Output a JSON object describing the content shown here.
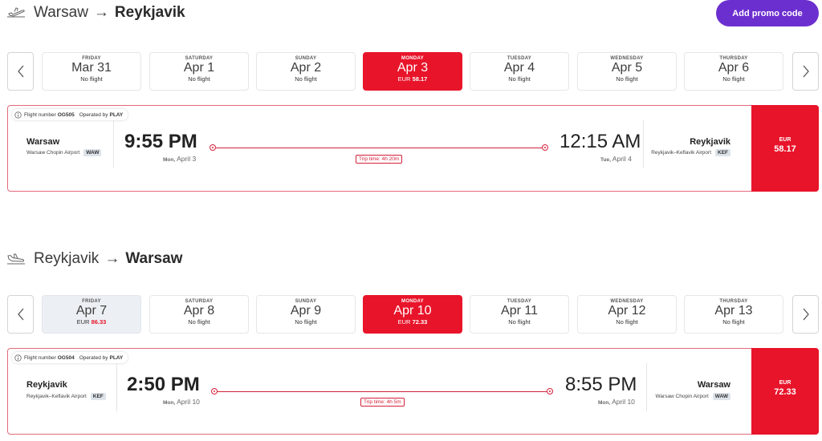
{
  "promo": {
    "label": "Add promo code"
  },
  "outbound": {
    "from": "Warsaw",
    "arrow": "→",
    "to": "Reykjavik",
    "days": [
      {
        "weekday": "FRIDAY",
        "date": "Mar 31",
        "status": "No flight"
      },
      {
        "weekday": "SATURDAY",
        "date": "Apr 1",
        "status": "No flight"
      },
      {
        "weekday": "SUNDAY",
        "date": "Apr 2",
        "status": "No flight"
      },
      {
        "weekday": "MONDAY",
        "date": "Apr 3",
        "currency": "EUR",
        "price": "58.17"
      },
      {
        "weekday": "TUESDAY",
        "date": "Apr 4",
        "status": "No flight"
      },
      {
        "weekday": "WEDNESDAY",
        "date": "Apr 5",
        "status": "No flight"
      },
      {
        "weekday": "THURSDAY",
        "date": "Apr 6",
        "status": "No flight"
      }
    ],
    "flight": {
      "number_label": "Flight number",
      "number": "OG505",
      "operated_label": "Operated by",
      "operator": "PLAY",
      "origin_city": "Warsaw",
      "origin_airport": "Warsaw Chopin Airport",
      "origin_code": "WAW",
      "depart_time": "9:55 PM",
      "depart_day": "Mon,",
      "depart_date": "April 3",
      "trip_time": "Trip time: 4h 20m",
      "arrive_time": "12:15 AM",
      "arrive_day": "Tue,",
      "arrive_date": "April 4",
      "dest_city": "Reykjavik",
      "dest_airport": "Reykjavik–Keflavik Airport",
      "dest_code": "KEF",
      "currency": "EUR",
      "price": "58.17"
    }
  },
  "return": {
    "from": "Reykjavik",
    "arrow": "→",
    "to": "Warsaw",
    "days": [
      {
        "weekday": "FRIDAY",
        "date": "Apr 7",
        "currency": "EUR",
        "price": "86.33"
      },
      {
        "weekday": "SATURDAY",
        "date": "Apr 8",
        "status": "No flight"
      },
      {
        "weekday": "SUNDAY",
        "date": "Apr 9",
        "status": "No flight"
      },
      {
        "weekday": "MONDAY",
        "date": "Apr 10",
        "currency": "EUR",
        "price": "72.33"
      },
      {
        "weekday": "TUESDAY",
        "date": "Apr 11",
        "status": "No flight"
      },
      {
        "weekday": "WEDNESDAY",
        "date": "Apr 12",
        "status": "No flight"
      },
      {
        "weekday": "THURSDAY",
        "date": "Apr 13",
        "status": "No flight"
      }
    ],
    "flight": {
      "number_label": "Flight number",
      "number": "OG504",
      "operated_label": "Operated by",
      "operator": "PLAY",
      "origin_city": "Reykjavik",
      "origin_airport": "Reykjavik–Keflavik Airport",
      "origin_code": "KEF",
      "depart_time": "2:50 PM",
      "depart_day": "Mon,",
      "depart_date": "April 10",
      "trip_time": "Trip time: 4h 5m",
      "arrive_time": "8:55 PM",
      "arrive_day": "Mon,",
      "arrive_date": "April 10",
      "dest_city": "Warsaw",
      "dest_airport": "Warsaw Chopin Airport",
      "dest_code": "WAW",
      "currency": "EUR",
      "price": "72.33"
    }
  },
  "icons": {
    "departure": "plane-takeoff-icon",
    "arrival": "plane-landing-icon",
    "prev": "chevron-left-icon",
    "next": "chevron-right-icon",
    "info": "info-icon"
  },
  "colors": {
    "accent": "#e8142a",
    "promo": "#6c2fcf"
  }
}
